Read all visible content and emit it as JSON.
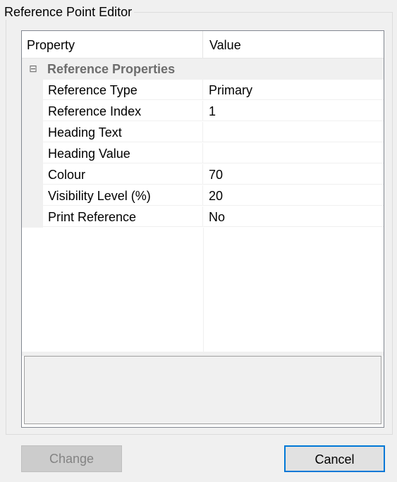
{
  "window": {
    "title": "Reference Point Editor"
  },
  "grid": {
    "columns": {
      "property": "Property",
      "value": "Value"
    },
    "category": {
      "label": "Reference Properties",
      "toggle_icon": "⊟"
    },
    "rows": [
      {
        "name": "Reference Type",
        "value": "Primary"
      },
      {
        "name": "Reference Index",
        "value": "1"
      },
      {
        "name": "Heading Text",
        "value": ""
      },
      {
        "name": "Heading Value",
        "value": ""
      },
      {
        "name": "Colour",
        "value": "70"
      },
      {
        "name": "Visibility Level (%)",
        "value": "20"
      },
      {
        "name": "Print Reference",
        "value": "No"
      }
    ]
  },
  "buttons": {
    "change": "Change",
    "change_enabled": false,
    "cancel": "Cancel"
  },
  "colors": {
    "focus_border": "#0078d7",
    "category_text": "#6d6d6d"
  }
}
